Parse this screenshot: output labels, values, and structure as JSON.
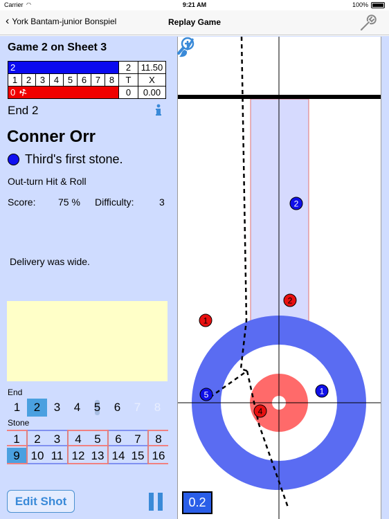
{
  "status_bar": {
    "carrier": "Carrier",
    "time": "9:21 AM",
    "battery": "100%"
  },
  "nav": {
    "back_label": "York Bantam-junior Bonspiel",
    "title": "Replay Game"
  },
  "game": {
    "title": "Game 2 on Sheet 3",
    "scoreboard": {
      "blue_row": {
        "team": "2",
        "total": "2",
        "time": "11.50"
      },
      "end_row": {
        "ends": [
          "1",
          "2",
          "3",
          "4",
          "5",
          "6",
          "7",
          "8"
        ],
        "total": "T",
        "time": "X"
      },
      "red_row": {
        "team": "0",
        "total": "0",
        "time": "0.00"
      }
    },
    "end_label": "End 2"
  },
  "shot": {
    "player": "Conner Orr",
    "stone_desc": "Third's first stone.",
    "type": "Out-turn Hit & Roll",
    "score_label": "Score:",
    "score_value": "75 %",
    "difficulty_label": "Difficulty:",
    "difficulty_value": "3",
    "comment": "Delivery was wide.",
    "stone_color": "#1010f0"
  },
  "selector": {
    "end_label": "End",
    "ends": [
      "1",
      "2",
      "3",
      "4",
      "5",
      "6",
      "7",
      "8"
    ],
    "selected_end": "2",
    "stone_label": "Stone",
    "stones_row1": [
      "1",
      "2",
      "3",
      "4",
      "5",
      "6",
      "7",
      "8"
    ],
    "stones_row2": [
      "9",
      "10",
      "11",
      "12",
      "13",
      "14",
      "15",
      "16"
    ],
    "selected_stone": "9"
  },
  "buttons": {
    "edit_shot": "Edit Shot"
  },
  "sheet": {
    "speed": "0.2",
    "stones": [
      {
        "num": "2",
        "color": "blue"
      },
      {
        "num": "2",
        "color": "red"
      },
      {
        "num": "1",
        "color": "red"
      },
      {
        "num": "5",
        "color": "blue"
      },
      {
        "num": "1",
        "color": "blue"
      },
      {
        "num": "4",
        "color": "red"
      }
    ]
  },
  "colors": {
    "panel_bg": "#cfdcff",
    "team_blue": "#0a0af0",
    "team_red": "#f00000",
    "house_12ft": "#5a6cf2",
    "house_4ft": "#ff6a6a",
    "accent": "#3a8ad8"
  },
  "icons": {
    "back": "chevron-left-icon",
    "settings": "wrench-icon",
    "info": "info-icon",
    "hammer": "hammer-icon",
    "draw": "brush-icon",
    "zoom": "zoom-in-icon",
    "pause": "pause-icon"
  }
}
